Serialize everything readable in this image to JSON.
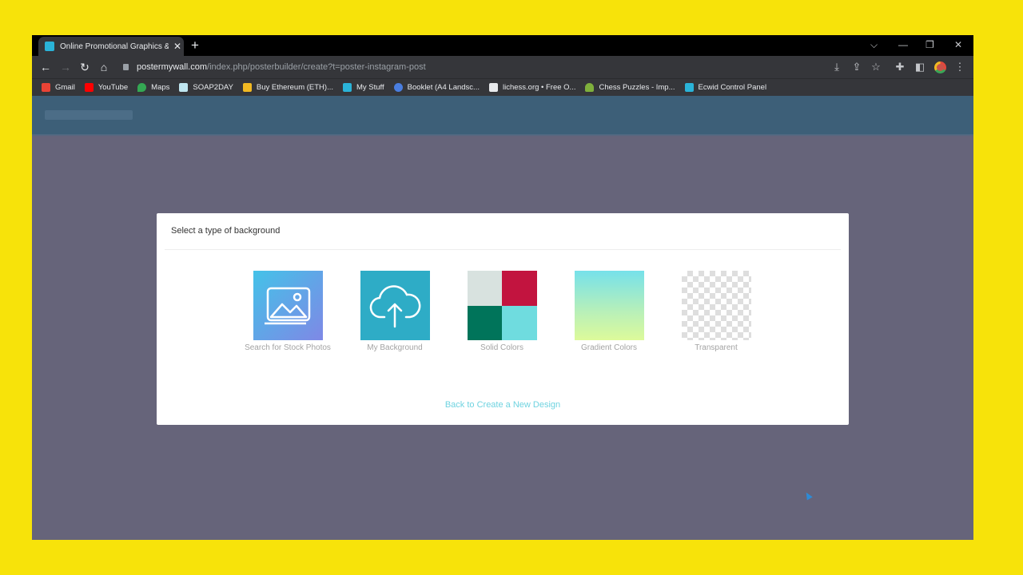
{
  "browser": {
    "tab": {
      "title": "Online Promotional Graphics & V"
    },
    "new_tab": "+",
    "window_controls": {
      "tabsearch": "⌵",
      "minimize": "—",
      "restore": "❐",
      "close": "✕"
    },
    "url": {
      "host": "postermywall.com",
      "path": "/index.php/posterbuilder/create?t=poster-instagram-post"
    },
    "bookmarks": [
      {
        "label": "Gmail",
        "color": "#ea4335"
      },
      {
        "label": "YouTube",
        "color": "#ff0000"
      },
      {
        "label": "Maps",
        "color": "#34a853"
      },
      {
        "label": "SOAP2DAY",
        "color": "#bfe6f0"
      },
      {
        "label": "Buy Ethereum (ETH)...",
        "color": "#f2b922"
      },
      {
        "label": "My Stuff",
        "color": "#2ab3d8"
      },
      {
        "label": "Booklet (A4 Landsc...",
        "color": "#4a7ee0"
      },
      {
        "label": "lichess.org • Free O...",
        "color": "#e8eaed"
      },
      {
        "label": "Chess Puzzles - Imp...",
        "color": "#7fb03c"
      },
      {
        "label": "Ecwid Control Panel",
        "color": "#2ab3d8"
      }
    ]
  },
  "modal": {
    "title": "Select a type of background",
    "options": [
      {
        "label": "Search for Stock Photos",
        "icon": "image-icon"
      },
      {
        "label": "My Background",
        "icon": "cloud-upload-icon"
      },
      {
        "label": "Solid Colors",
        "colors": [
          "#d8e2df",
          "#c2143f",
          "#00745a",
          "#6fdcdf"
        ]
      },
      {
        "label": "Gradient Colors"
      },
      {
        "label": "Transparent"
      }
    ],
    "back_link": "Back to Create a New Design"
  },
  "colors": {
    "frame": "#f7e30a",
    "overlay": "#66647a",
    "link": "#6fd3e0"
  }
}
